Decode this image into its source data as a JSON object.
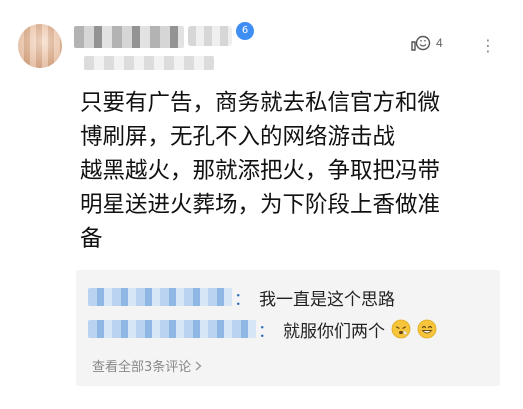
{
  "comment": {
    "level_badge": "6",
    "like_count": "4",
    "more_icon": "⋮",
    "text_lines": [
      "只要有广告，商务就去私信官方和微",
      "博刷屏，无孔不入的网络游击战",
      "越黑越火，那就添把火，争取把冯带",
      "明星送进火葬场，为下阶段上香做准",
      "备"
    ]
  },
  "replies": {
    "items": [
      {
        "colon": "：",
        "text": "我一直是这个思路",
        "emojis": []
      },
      {
        "colon": "：",
        "text": "就服你们两个",
        "emojis": [
          "sneeze-face-icon",
          "grin-face-icon"
        ]
      }
    ],
    "view_all": "查看全部3条评论"
  },
  "colors": {
    "accent": "#3f8ef4",
    "reply_bg": "#f4f4f4",
    "name_link": "#2f6fbf"
  }
}
